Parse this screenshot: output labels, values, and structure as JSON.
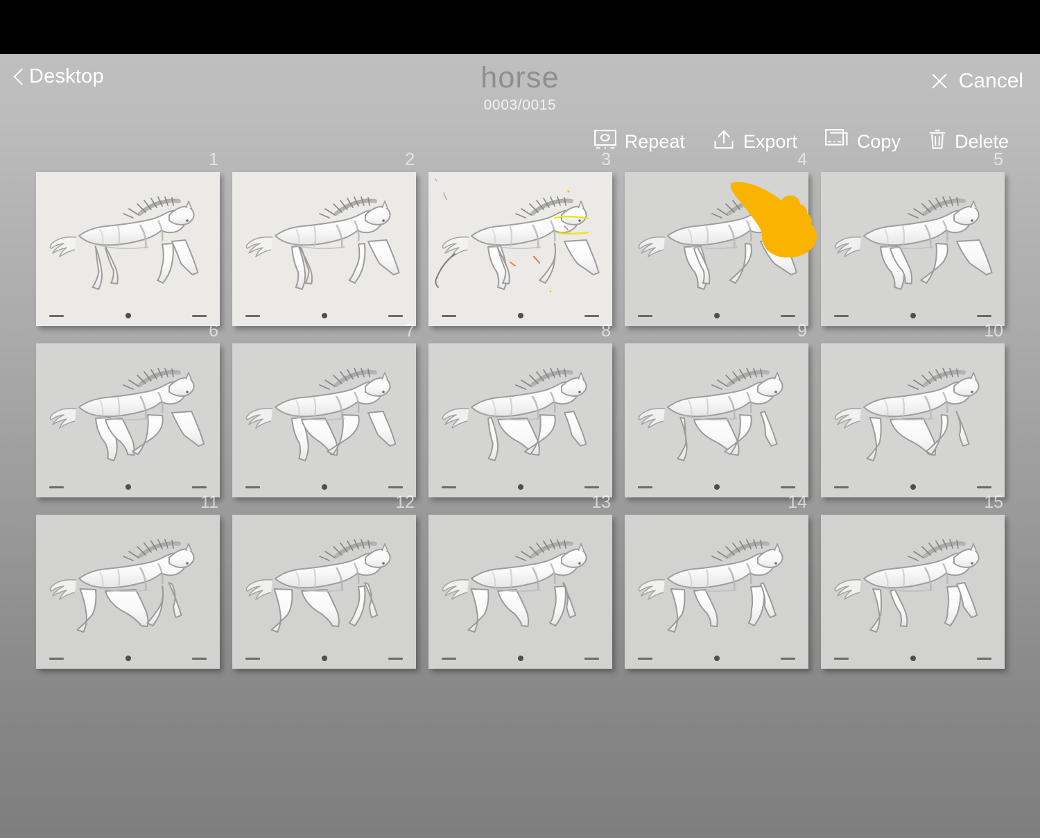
{
  "window": {
    "status_bar_color": "#000000",
    "background_top_color": "#bfbfbf",
    "background_bottom_color": "#7e7e7e"
  },
  "nav": {
    "back_label": "Desktop",
    "back_icon": "chevron-left-icon",
    "title": "horse",
    "counter": "0003/0015",
    "cancel_label": "Cancel",
    "cancel_icon": "close-x-icon"
  },
  "toolbar": {
    "items": [
      {
        "label": "Repeat",
        "icon": "repeat-frame-icon"
      },
      {
        "label": "Export",
        "icon": "export-upload-icon"
      },
      {
        "label": "Copy",
        "icon": "copy-frames-icon"
      },
      {
        "label": "Delete",
        "icon": "trash-icon"
      }
    ]
  },
  "cursor": {
    "type": "pointing-hand-cursor",
    "color": "#FAB400",
    "over_label": "Export"
  },
  "grid": {
    "columns": 5,
    "rows": 3,
    "total_frames": 15,
    "frames": [
      {
        "number": "1",
        "tone": "bright",
        "annotated": false
      },
      {
        "number": "2",
        "tone": "bright",
        "annotated": false
      },
      {
        "number": "3",
        "tone": "bright",
        "annotated": true
      },
      {
        "number": "4",
        "tone": "dim",
        "annotated": false
      },
      {
        "number": "5",
        "tone": "dim",
        "annotated": false
      },
      {
        "number": "6",
        "tone": "dim",
        "annotated": false
      },
      {
        "number": "7",
        "tone": "dim",
        "annotated": false
      },
      {
        "number": "8",
        "tone": "dim",
        "annotated": false
      },
      {
        "number": "9",
        "tone": "dim",
        "annotated": false
      },
      {
        "number": "10",
        "tone": "dim",
        "annotated": false
      },
      {
        "number": "11",
        "tone": "dim2",
        "annotated": false
      },
      {
        "number": "12",
        "tone": "dim2",
        "annotated": false
      },
      {
        "number": "13",
        "tone": "dim2",
        "annotated": false
      },
      {
        "number": "14",
        "tone": "dim2",
        "annotated": false
      },
      {
        "number": "15",
        "tone": "dim2",
        "annotated": false
      }
    ],
    "frame_marks": {
      "left": "dash",
      "center": "dot",
      "right": "dash"
    },
    "subject": "galloping horse pencil sketch"
  }
}
